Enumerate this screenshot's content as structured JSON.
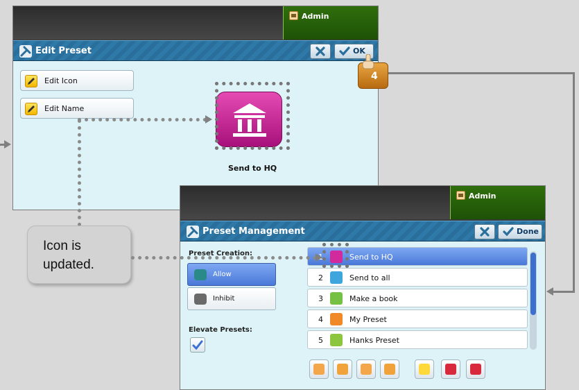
{
  "edit_preset": {
    "admin_label": "Admin",
    "title": "Edit Preset",
    "ok_label": "OK",
    "edit_icon_label": "Edit Icon",
    "edit_name_label": "Edit Name",
    "preset_name": "Send to HQ"
  },
  "step_badge": "4",
  "callout": {
    "line1": "Icon is",
    "line2": "updated."
  },
  "preset_management": {
    "admin_label": "Admin",
    "title": "Preset Management",
    "done_label": "Done",
    "preset_creation_label": "Preset Creation:",
    "allow_label": "Allow",
    "inhibit_label": "Inhibit",
    "elevate_label": "Elevate Presets:",
    "presets": [
      {
        "num": "1",
        "name": "Send to HQ",
        "color": "#d12a9d"
      },
      {
        "num": "2",
        "name": "Send to all",
        "color": "#3fa6dd"
      },
      {
        "num": "3",
        "name": "Make a book",
        "color": "#76c043"
      },
      {
        "num": "4",
        "name": "My Preset",
        "color": "#f08a28"
      },
      {
        "num": "5",
        "name": "Hanks Preset",
        "color": "#8cc63f"
      }
    ]
  },
  "colors": {
    "accent_blue": "#2a6f9c",
    "selected_row": "#4a78d8",
    "admin_green": "#2f6e0c",
    "panel_bg": "#ddf3f7",
    "icon_magenta": "#c51a8a",
    "badge_orange": "#d58a1c"
  },
  "icons": [
    "tools-icon",
    "close-icon",
    "check-icon",
    "pencil-icon",
    "bank-icon",
    "eye-icon",
    "eye-slash-icon",
    "arrow-up-icon",
    "arrow-down-icon",
    "delete-icon",
    "hand-pointer-icon"
  ]
}
